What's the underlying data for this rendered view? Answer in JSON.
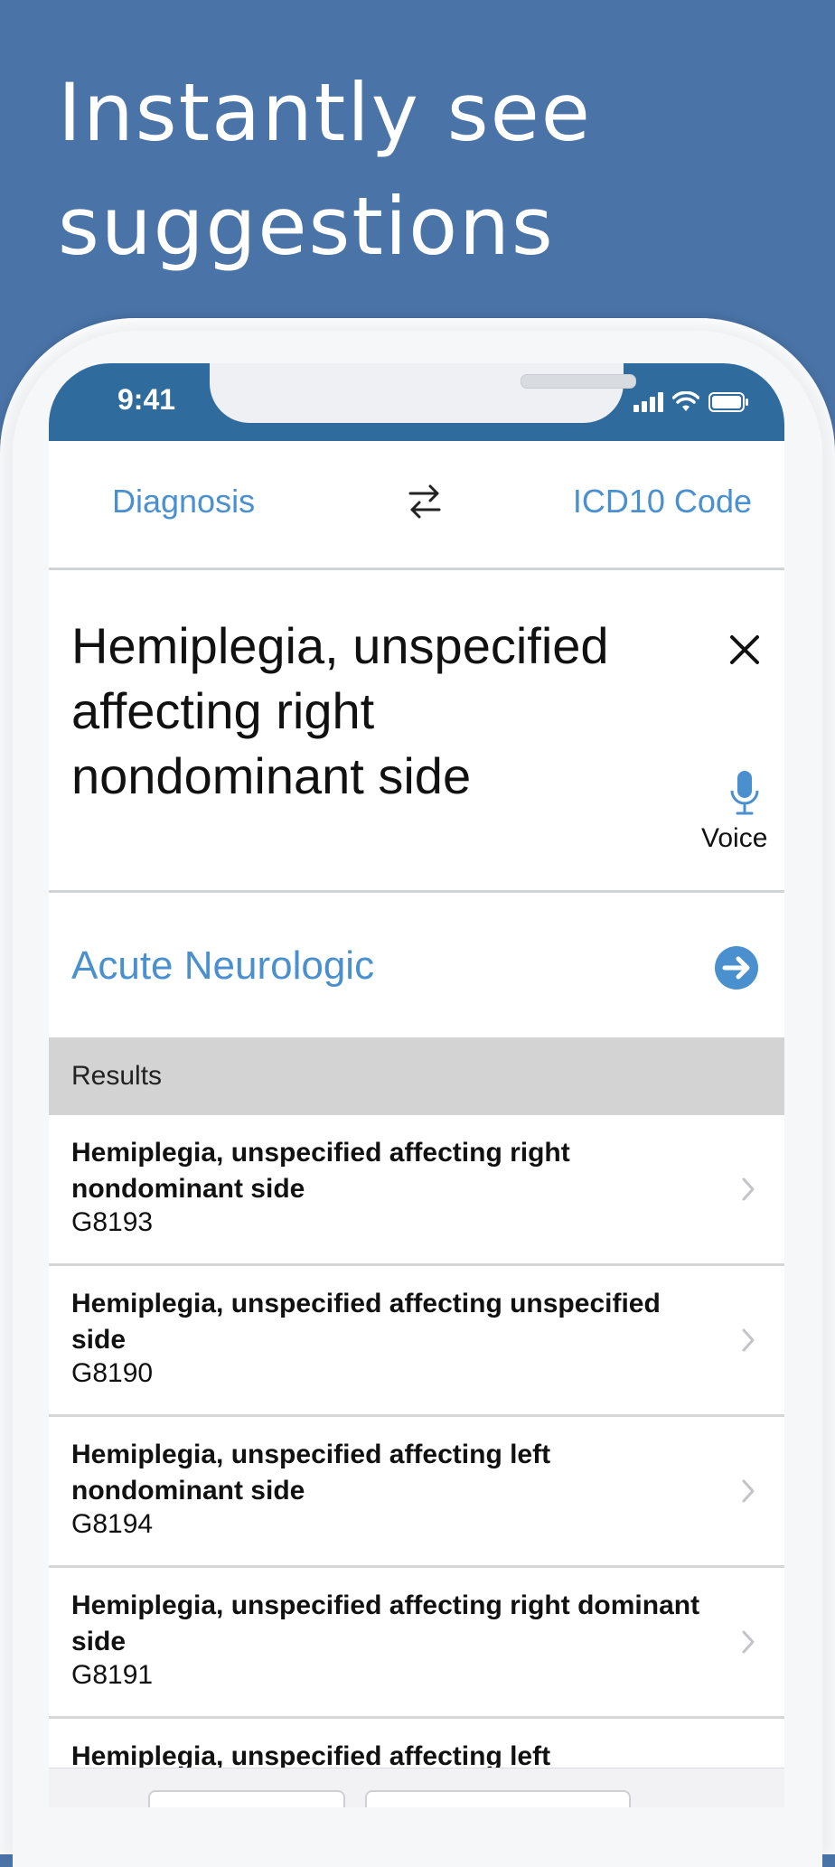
{
  "headline": {
    "line1": "Instantly see",
    "line2": "suggestions"
  },
  "status_bar": {
    "time": "9:41",
    "icons": [
      "signal-icon",
      "wifi-icon",
      "battery-icon"
    ]
  },
  "segment": {
    "left_label": "Diagnosis",
    "right_label": "ICD10 Code",
    "swap_icon": "swap-arrows-icon"
  },
  "query": {
    "text": "Hemiplegia, unspecified affecting right nondominant side",
    "voice_label": "Voice"
  },
  "category": {
    "label": "Acute Neurologic"
  },
  "results": {
    "header": "Results",
    "items": [
      {
        "title": "Hemiplegia, unspecified affecting right nondominant side",
        "code": "G8193"
      },
      {
        "title": "Hemiplegia, unspecified affecting unspecified side",
        "code": "G8190"
      },
      {
        "title": "Hemiplegia, unspecified affecting left nondominant side",
        "code": "G8194"
      },
      {
        "title": "Hemiplegia, unspecified affecting right dominant side",
        "code": "G8191"
      },
      {
        "title": "Hemiplegia, unspecified affecting left",
        "code": ""
      }
    ]
  },
  "colors": {
    "background": "#4a74a8",
    "status_bar": "#2f6b9c",
    "accent": "#4a90cf",
    "results_header": "#d3d3d3"
  }
}
